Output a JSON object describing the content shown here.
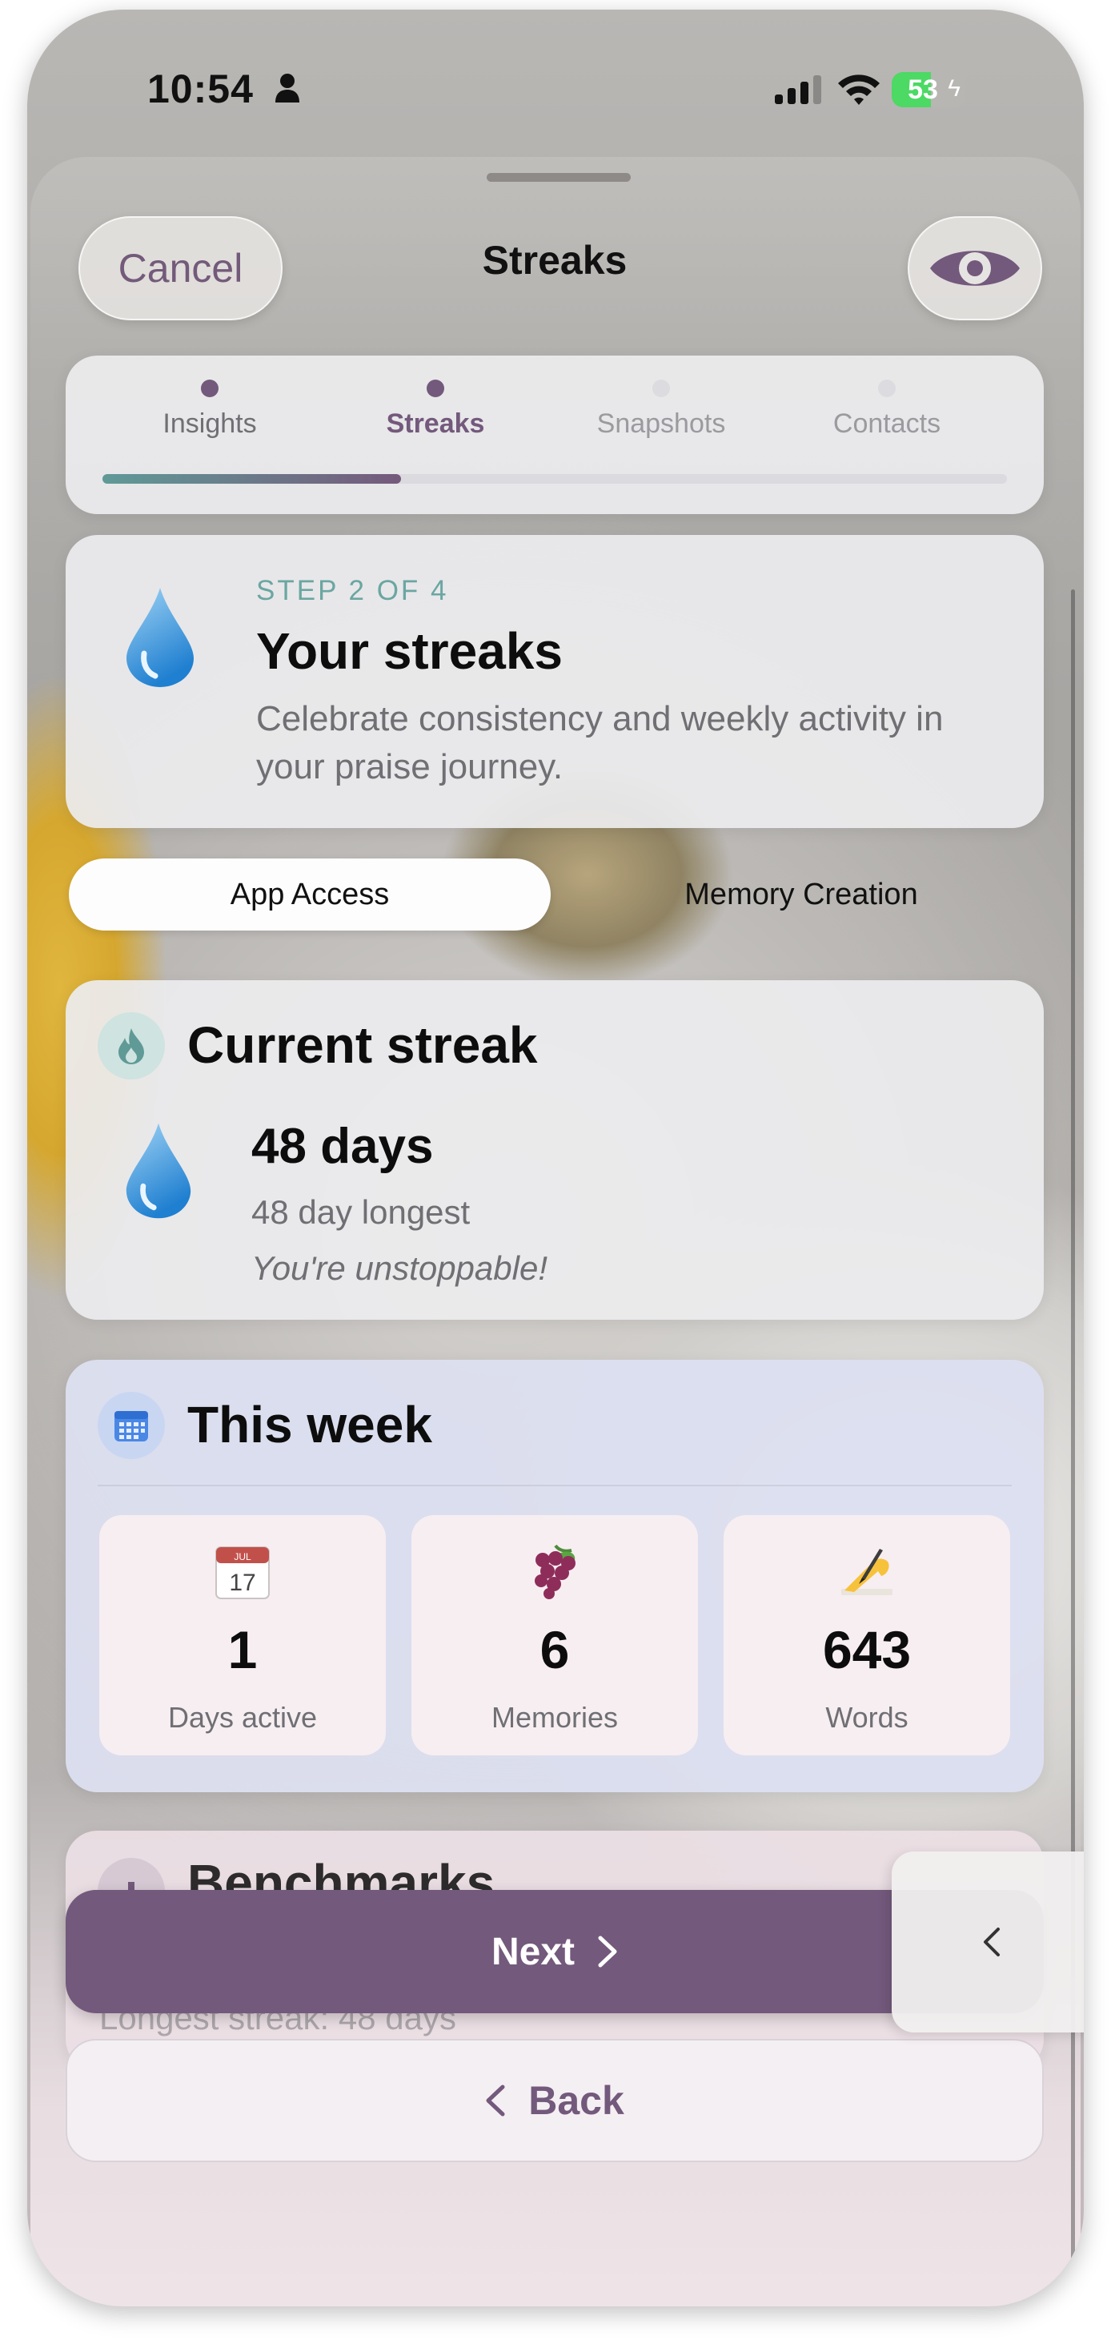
{
  "status_bar": {
    "time": "10:54",
    "battery_level": "53",
    "battery_fraction": 0.53
  },
  "nav": {
    "cancel_label": "Cancel",
    "title": "Streaks",
    "eye_icon": "eye-icon"
  },
  "progress": {
    "steps": [
      {
        "label": "Insights",
        "state": "done"
      },
      {
        "label": "Streaks",
        "state": "current"
      },
      {
        "label": "Snapshots",
        "state": "upcoming"
      },
      {
        "label": "Contacts",
        "state": "upcoming"
      }
    ],
    "completed_fraction": 0.33
  },
  "step_card": {
    "step_text": "STEP 2 OF 4",
    "title": "Your streaks",
    "description": "Celebrate consistency and weekly activity in your praise journey."
  },
  "segmented": {
    "options": [
      "App Access",
      "Memory Creation"
    ],
    "selected": "App Access"
  },
  "current_streak": {
    "title": "Current streak",
    "days": "48 days",
    "longest": "48 day longest",
    "message": "You're unstoppable!"
  },
  "this_week": {
    "title": "This week",
    "stats": [
      {
        "icon": "calendar-icon",
        "value": "1",
        "label": "Days active"
      },
      {
        "icon": "grapes-icon",
        "value": "6",
        "label": "Memories"
      },
      {
        "icon": "writing-hand-icon",
        "value": "643",
        "label": "Words"
      }
    ]
  },
  "benchmarks": {
    "title": "Benchmarks",
    "subtitle": "Longest streak: 48 days"
  },
  "buttons": {
    "next_label": "Next",
    "back_label": "Back"
  },
  "colors": {
    "accent": "#73597c",
    "teal": "#6ba6a2",
    "progress_start": "#5f9a97",
    "progress_end": "#76597c"
  }
}
